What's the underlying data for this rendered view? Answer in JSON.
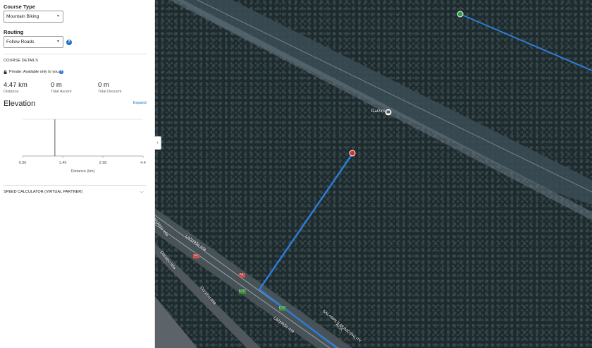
{
  "sidebar": {
    "course_type_label": "Course Type",
    "course_type_value": "Mountain Biking",
    "routing_label": "Routing",
    "routing_value": "Follow Roads",
    "course_details_label": "COURSE DETAILS",
    "privacy_text": "Private: Available only to you.",
    "stats": [
      {
        "value": "4.47 km",
        "label": "Distance"
      },
      {
        "value": "0 m",
        "label": "Total Ascent"
      },
      {
        "value": "0 m",
        "label": "Total Descent"
      }
    ],
    "elevation_title": "Elevation",
    "expand_label": "Expand",
    "speed_calculator_label": "SPEED CALCULATOR (VIRTUAL PARTNER)"
  },
  "chart_data": {
    "type": "line",
    "xlabel": "Distance (km)",
    "x_ticks": [
      "0.00",
      "1.49",
      "2.98",
      "4.4"
    ],
    "xlim": [
      0,
      4.47
    ],
    "series": [
      {
        "x": [
          0,
          1.2,
          4.47
        ],
        "y": [
          0,
          0,
          0
        ]
      }
    ],
    "grid": "horizontal"
  },
  "map": {
    "labels": {
      "darzini": "Darziņi",
      "lacplesa1": "Lāčplēša iela",
      "lacplesa2": "Lāčplēša iela",
      "lacplesa3": "Lāčplēša iela",
      "darzini_iela1": "Darziņu iela",
      "darzini_iela2": "Darziņu iela",
      "salaspils": "SALASPILS MUNICIPALITY",
      "road": "ROA",
      "road_a4_1": "A4",
      "road_a4_2": "A4",
      "road_e22": "E22",
      "road_e22b": "E22"
    },
    "colors": {
      "route": "#2e7bd6",
      "start": "#2ea043",
      "end": "#d93025"
    }
  }
}
